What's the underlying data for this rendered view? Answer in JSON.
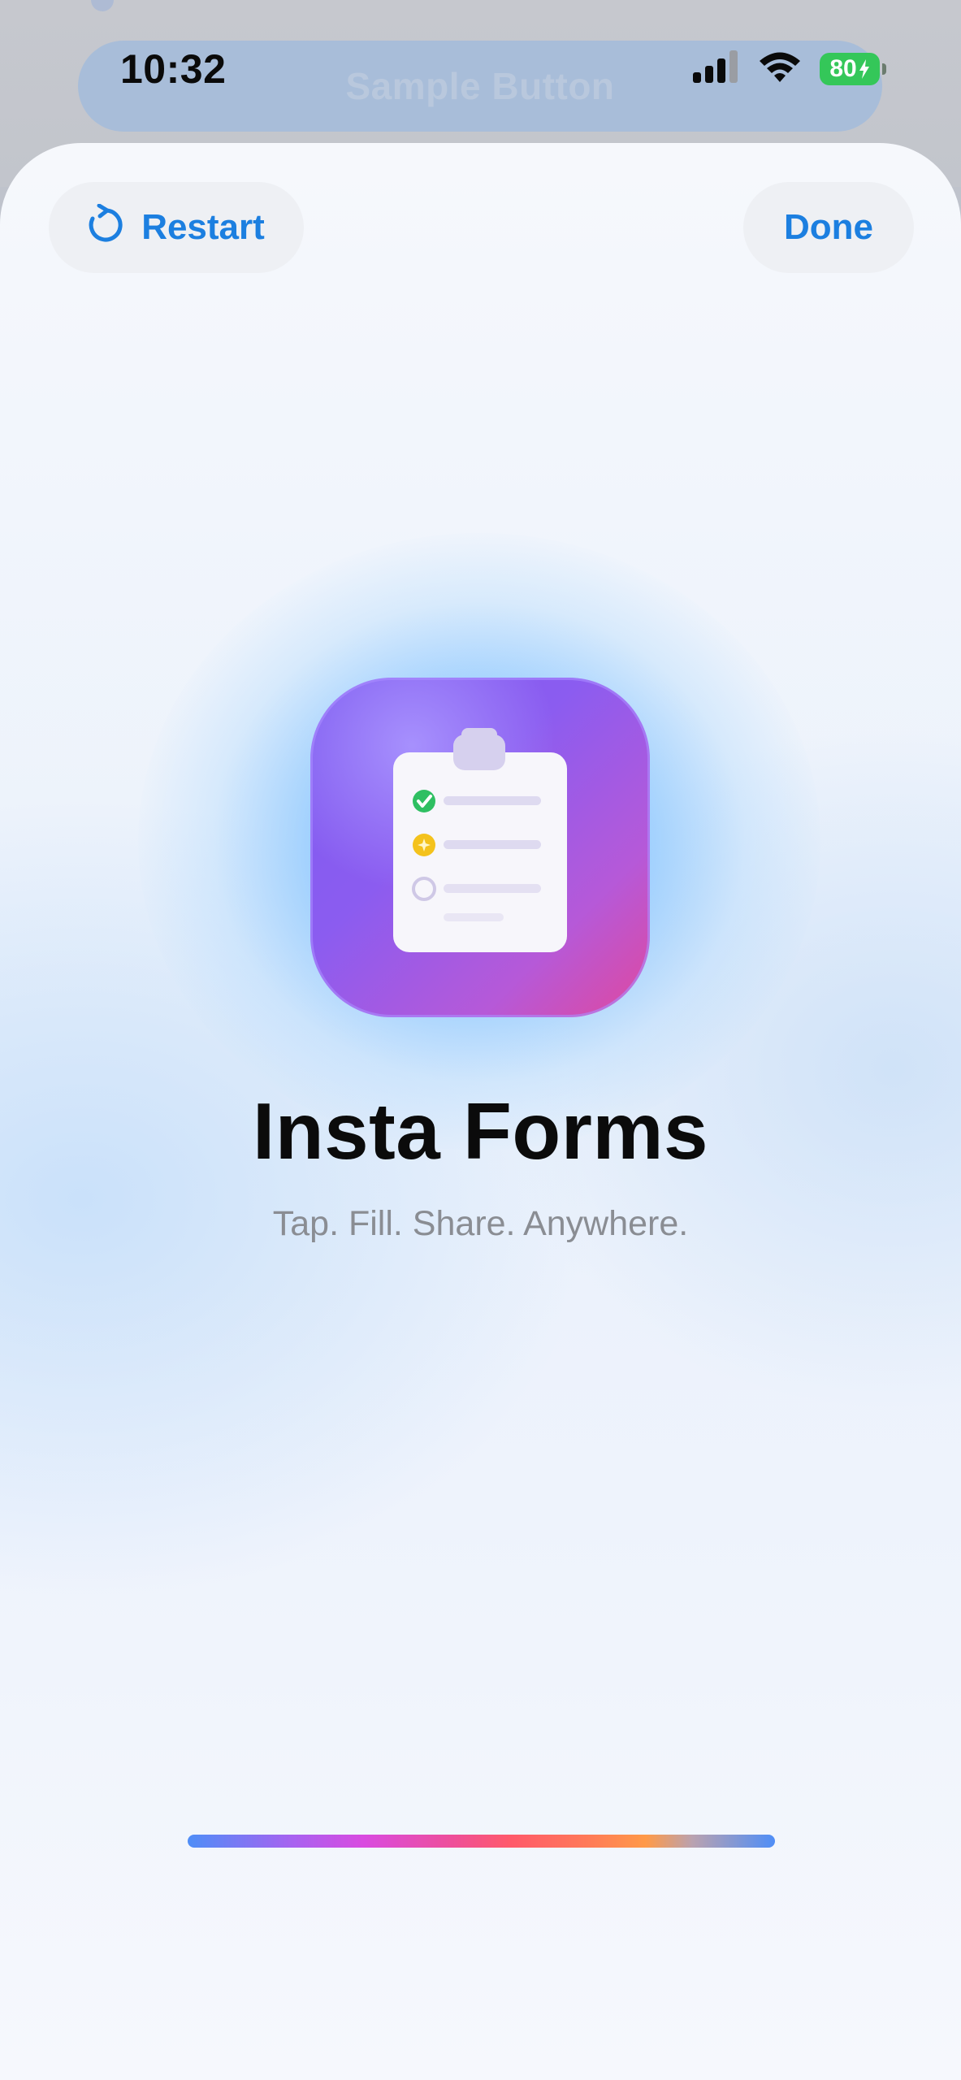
{
  "status_bar": {
    "time": "10:32",
    "battery": "80",
    "icons": [
      "cellular-signal-icon",
      "wifi-icon",
      "battery-charging-icon"
    ]
  },
  "background": {
    "sample_button_label": "Sample Button"
  },
  "sheet": {
    "restart_label": "Restart",
    "restart_icon": "restart-arrow-icon",
    "done_label": "Done",
    "app_icon": "clipboard-checklist-icon",
    "title": "Insta Forms",
    "subtitle": "Tap. Fill. Share. Anywhere."
  },
  "colors": {
    "accent": "#1c7fe0",
    "battery_green": "#34c759",
    "icon_gradient_start": "#7d5cf0",
    "icon_gradient_end": "#e0489e",
    "title_text": "#0b0b0b",
    "subtitle_text": "#8a8d93"
  }
}
